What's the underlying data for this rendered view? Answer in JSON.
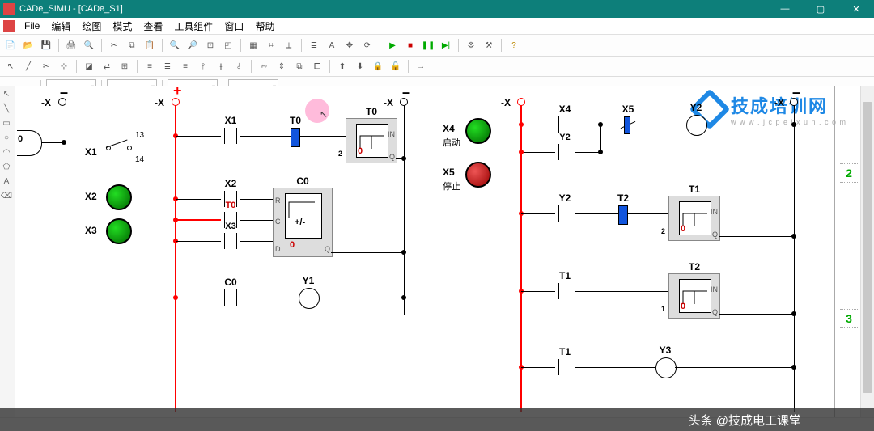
{
  "title": "CADe_SIMU - [CADe_S1]",
  "menu": {
    "file": "File",
    "edit": "编辑",
    "draw": "绘图",
    "mode": "模式",
    "view": "查看",
    "tools": "工具组件",
    "window": "窗口",
    "help": "帮助"
  },
  "logo": {
    "line1": "技成培训网",
    "line2": "w w w . j c p e i x u n . c o m"
  },
  "footer": "头条 @技成电工课堂",
  "gutter": {
    "n2": "2",
    "n3": "3"
  },
  "rails": {
    "neg": "–",
    "xr": "-X",
    "xr2": "-X",
    "xr3": "-X",
    "xr4": "-X",
    "plus": "+"
  },
  "inputs": {
    "x1": "X1",
    "x2": "X2",
    "x3": "X3",
    "x4": "X4",
    "x4sub": "启动",
    "x5": "X5",
    "x5sub": "停止"
  },
  "labels": {
    "x1b": "X1",
    "t0": "T0",
    "t0b": "T0",
    "x2": "X2",
    "c0": "C0",
    "t0c": "T0",
    "x3b": "X3",
    "c0b": "C0",
    "y1": "Y1",
    "x4": "X4",
    "x5": "X5",
    "y2": "Y2",
    "y2b": "Y2",
    "y2c": "Y2",
    "t2": "T2",
    "t1": "T1",
    "t1b": "T1",
    "t2b": "T2",
    "t1c": "T1",
    "y3": "Y3"
  },
  "fb": {
    "t0": {
      "title": "T0",
      "in": "IN",
      "q": "Q",
      "pre": "2",
      "val": "0"
    },
    "c0": {
      "title": "C0",
      "r": "R",
      "c": "C",
      "d": "D",
      "q": "Q",
      "sym": "+/-",
      "val": "0"
    },
    "t1": {
      "title": "T1",
      "in": "IN",
      "q": "Q",
      "pre": "2",
      "val": "0"
    },
    "t2": {
      "title": "T2",
      "in": "IN",
      "q": "Q",
      "pre": "1",
      "val": "0"
    }
  },
  "sw": {
    "l1": "13",
    "l2": "14"
  },
  "zero": "0"
}
